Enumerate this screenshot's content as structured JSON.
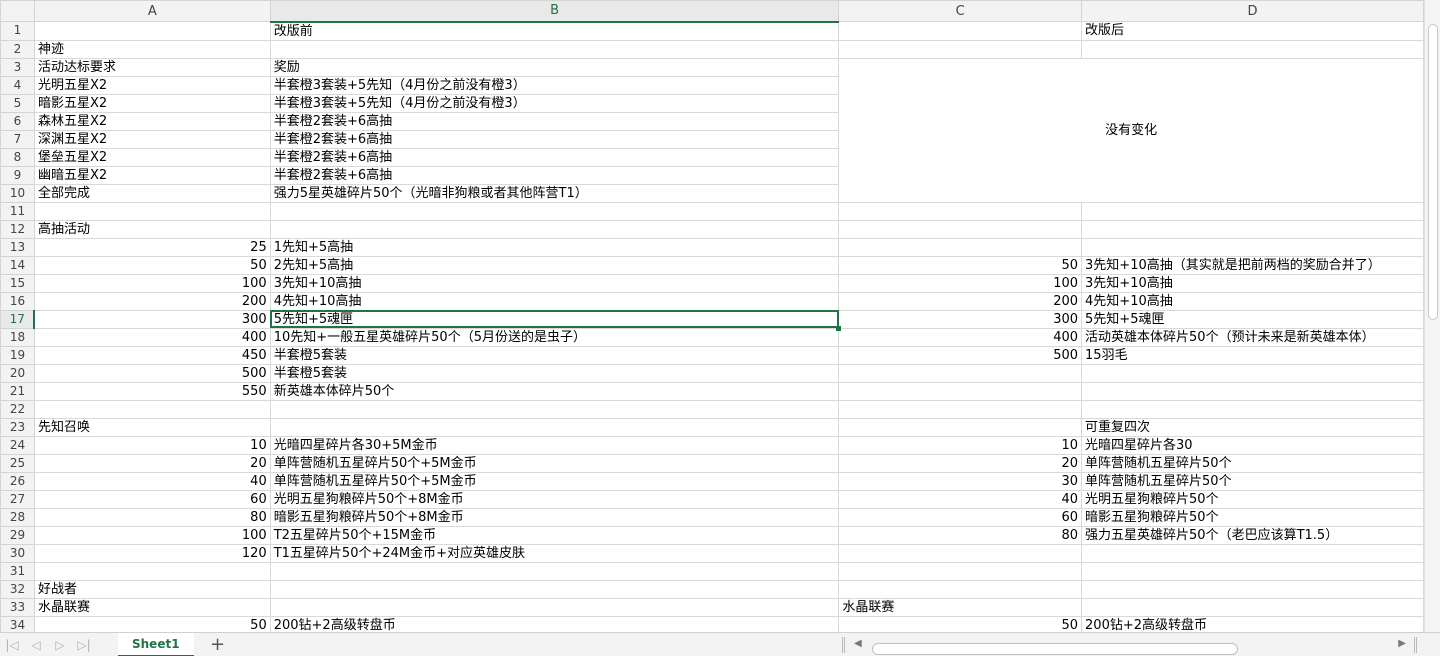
{
  "columns": [
    "A",
    "B",
    "C",
    "D"
  ],
  "active_column": "B",
  "active_row": 17,
  "merged_note": "没有变化",
  "rows": [
    [
      "",
      "改版前",
      "",
      "改版后"
    ],
    [
      "神迹",
      "",
      "",
      ""
    ],
    [
      "活动达标要求",
      "奖励",
      "",
      ""
    ],
    [
      "光明五星X2",
      "半套橙3套装+5先知（4月份之前没有橙3）",
      "",
      ""
    ],
    [
      "暗影五星X2",
      "半套橙3套装+5先知（4月份之前没有橙3）",
      "",
      ""
    ],
    [
      "森林五星X2",
      "半套橙2套装+6高抽",
      "",
      ""
    ],
    [
      "深渊五星X2",
      "半套橙2套装+6高抽",
      "",
      ""
    ],
    [
      "堡垒五星X2",
      "半套橙2套装+6高抽",
      "",
      ""
    ],
    [
      "幽暗五星X2",
      "半套橙2套装+6高抽",
      "",
      ""
    ],
    [
      "全部完成",
      "强力5星英雄碎片50个（光暗非狗粮或者其他阵营T1）",
      "",
      ""
    ],
    [
      "",
      "",
      "",
      ""
    ],
    [
      "高抽活动",
      "",
      "",
      ""
    ],
    [
      "25",
      "1先知+5高抽",
      "",
      ""
    ],
    [
      "50",
      "2先知+5高抽",
      "50",
      "3先知+10高抽（其实就是把前两档的奖励合并了）"
    ],
    [
      "100",
      "3先知+10高抽",
      "100",
      "3先知+10高抽"
    ],
    [
      "200",
      "4先知+10高抽",
      "200",
      "4先知+10高抽"
    ],
    [
      "300",
      "5先知+5魂匣",
      "300",
      "5先知+5魂匣"
    ],
    [
      "400",
      "10先知+一般五星英雄碎片50个（5月份送的是虫子）",
      "400",
      "活动英雄本体碎片50个（预计未来是新英雄本体）"
    ],
    [
      "450",
      "半套橙5套装",
      "500",
      "15羽毛"
    ],
    [
      "500",
      "半套橙5套装",
      "",
      ""
    ],
    [
      "550",
      "新英雄本体碎片50个",
      "",
      ""
    ],
    [
      "",
      "",
      "",
      ""
    ],
    [
      "先知召唤",
      "",
      "",
      "可重复四次"
    ],
    [
      "10",
      "光暗四星碎片各30+5M金币",
      "10",
      "光暗四星碎片各30"
    ],
    [
      "20",
      "单阵营随机五星碎片50个+5M金币",
      "20",
      "单阵营随机五星碎片50个"
    ],
    [
      "40",
      "单阵营随机五星碎片50个+5M金币",
      "30",
      "单阵营随机五星碎片50个"
    ],
    [
      "60",
      "光明五星狗粮碎片50个+8M金币",
      "40",
      "光明五星狗粮碎片50个"
    ],
    [
      "80",
      "暗影五星狗粮碎片50个+8M金币",
      "60",
      "暗影五星狗粮碎片50个"
    ],
    [
      "100",
      "T2五星碎片50个+15M金币",
      "80",
      "强力五星英雄碎片50个（老巴应该算T1.5）"
    ],
    [
      "120",
      "T1五星碎片50个+24M金币+对应英雄皮肤",
      "",
      ""
    ],
    [
      "",
      "",
      "",
      ""
    ],
    [
      "好战者",
      "",
      "",
      ""
    ],
    [
      "水晶联赛",
      "",
      "水晶联赛",
      ""
    ],
    [
      "50",
      "200钻+2高级转盘币",
      "50",
      "200钻+2高级转盘币"
    ]
  ],
  "sheet_tab": "Sheet1",
  "add_sheet_icon": "plus-icon"
}
